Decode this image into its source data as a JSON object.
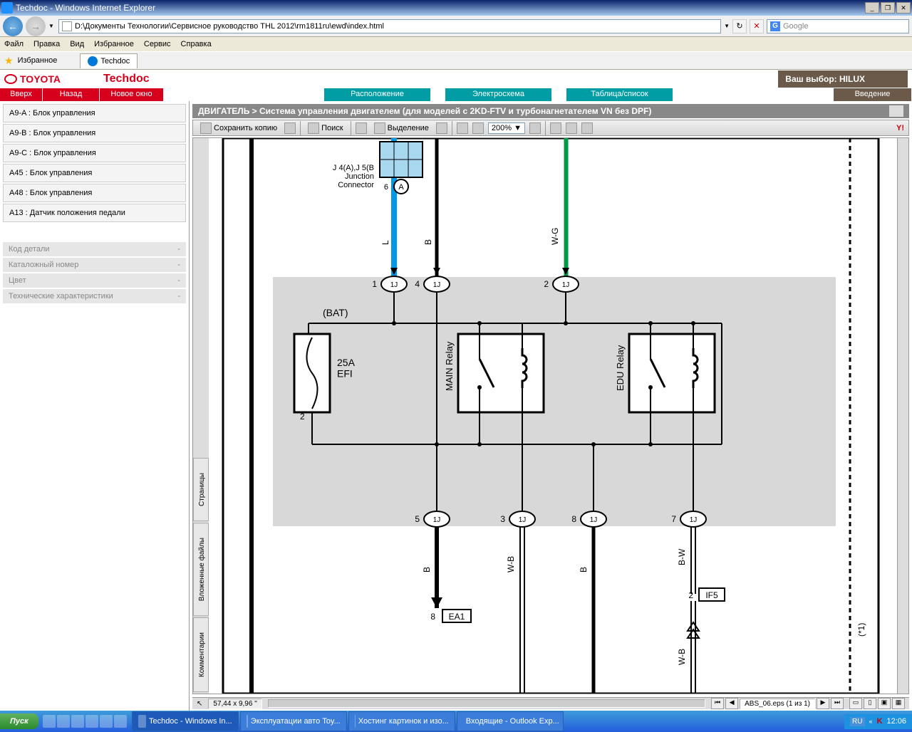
{
  "window": {
    "title": "Techdoc - Windows Internet Explorer",
    "minimize": "_",
    "restore": "❐",
    "close": "✕"
  },
  "address": "D:\\Документы Технологии\\Сервисное руководство THL 2012\\rm1811ru\\ewd\\index.html",
  "search_placeholder": "Google",
  "menu": {
    "file": "Файл",
    "edit": "Правка",
    "view": "Вид",
    "favorites": "Избранное",
    "service": "Сервис",
    "help": "Справка"
  },
  "fav": {
    "label": "Избранное",
    "tab": "Techdoc"
  },
  "header": {
    "brand": "TOYOTA",
    "app": "Techdoc",
    "choice_label": "Ваш выбор:",
    "choice_value": "HILUX"
  },
  "tabs": {
    "up": "Вверх",
    "back": "Назад",
    "new_window": "Новое окно",
    "location": "Расположение",
    "wiring": "Электросхема",
    "table": "Таблица/список",
    "intro": "Введение"
  },
  "sidebar": {
    "items": [
      "A9-A : Блок управления",
      "A9-B : Блок управления",
      "A9-C : Блок управления",
      "A45 : Блок управления",
      "A48 : Блок управления",
      "A13 : Датчик положения педали"
    ],
    "info": [
      {
        "label": "Код детали",
        "value": "-"
      },
      {
        "label": "Каталожный номер",
        "value": "-"
      },
      {
        "label": "Цвет",
        "value": "-"
      },
      {
        "label": "Технические характеристики",
        "value": "-"
      }
    ]
  },
  "breadcrumb": "ДВИГАТЕЛЬ > Система управления двигателем (для моделей с 2KD-FTV и турбонагнетателем VN без DPF)",
  "pdf": {
    "save": "Сохранить копию",
    "search": "Поиск",
    "select": "Выделение",
    "zoom": "200%",
    "tabs": {
      "pages": "Страницы",
      "attachments": "Вложенные файлы",
      "comments": "Комментарии"
    },
    "status_coords": "57,44 x 9,96 \"",
    "pager_file": "ABS_06.eps (1 из 1)"
  },
  "diagram": {
    "connector_label": "J 4(A),J 5(B\nJunction\nConnector",
    "pin6": "6",
    "pinA": "A",
    "wire_B": "B",
    "wire_L": "L",
    "wire_WG": "W-G",
    "wire_WB": "W-B",
    "wire_BW": "B-W",
    "bat": "(BAT)",
    "fuse": "25A\nEFI",
    "fuse_pin": "2",
    "main_relay": "MAIN Relay",
    "edu_relay": "EDU Relay",
    "pins": {
      "p1": "1",
      "p4": "4",
      "p2": "2",
      "p5": "5",
      "p3": "3",
      "p8": "8",
      "p7": "7"
    },
    "conn_1J": "1J",
    "ea1": "EA1",
    "ea1_pin": "8",
    "if5": "IF5",
    "if5_pin": "2",
    "note": "(*1)"
  },
  "taskbar": {
    "start": "Пуск",
    "items": [
      "Techdoc - Windows In...",
      "Эксплуатации авто Toy...",
      "Хостинг картинок и изо...",
      "Входящие - Outlook Exp..."
    ],
    "lang": "RU",
    "time": "12:06"
  }
}
